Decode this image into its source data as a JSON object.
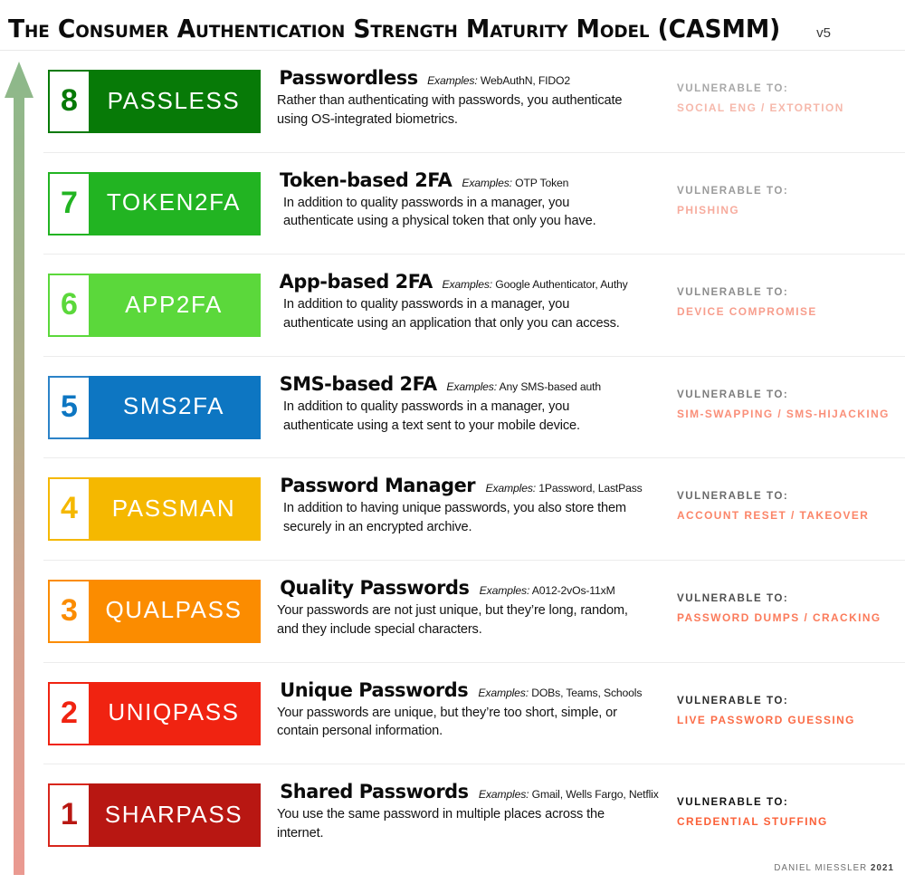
{
  "header": {
    "title": "The Consumer Authentication Strength Maturity Model (CASMM)",
    "version": "v5",
    "divider_color": "#e8e8e8"
  },
  "arrow": {
    "name": "maturity-arrow",
    "direction": "up",
    "gradient_top_color": "#8cb98a",
    "gradient_bottom_color": "#ea9a91"
  },
  "vulnerable_label": "VULNERABLE TO:",
  "rows": [
    {
      "number": "8",
      "badge_label": "PASSLESS",
      "color": "#077A07",
      "border_color": "#077A07",
      "title": "Passwordless",
      "examples_prefix": "Examples",
      "examples": "WebAuthN, FIDO2",
      "description": "Rather than authenticating with passwords, you authenticate using OS-integrated biometrics.",
      "vuln_label": "VULNERABLE TO:",
      "vuln_value": "SOCIAL ENG / EXTORTION",
      "vuln_label_color": "#a8a8a8",
      "vuln_value_color": "#f6b8ab",
      "indent": false
    },
    {
      "number": "7",
      "badge_label": "TOKEN2FA",
      "color": "#22B422",
      "border_color": "#22B422",
      "title": "Token-based 2FA",
      "examples_prefix": "Examples",
      "examples": "OTP Token",
      "description": "In addition to quality passwords in a manager, you authenticate using a physical token that only you have.",
      "vuln_label": "VULNERABLE TO:",
      "vuln_value": "PHISHING",
      "vuln_label_color": "#9b9b9b",
      "vuln_value_color": "#f7ab9d",
      "indent": true
    },
    {
      "number": "6",
      "badge_label": "APP2FA",
      "color": "#5BD83B",
      "border_color": "#5BD83B",
      "title": "App-based 2FA",
      "examples_prefix": "Examples",
      "examples": "Google Authenticator, Authy",
      "description": "In addition to quality passwords in a manager, you authenticate using an application that only you can access.",
      "vuln_label": "VULNERABLE TO:",
      "vuln_value": "DEVICE COMPROMISE",
      "vuln_label_color": "#8d8d8d",
      "vuln_value_color": "#f79d8c",
      "indent": true
    },
    {
      "number": "5",
      "badge_label": "SMS2FA",
      "color": "#0D76C2",
      "border_color": "#2C83C8",
      "title": "SMS-based 2FA",
      "examples_prefix": "Examples",
      "examples": "Any SMS-based auth",
      "description": "In addition to quality passwords in a manager, you authenticate using a text sent to your mobile device.",
      "vuln_label": "VULNERABLE TO:",
      "vuln_value": "SIM-SWAPPING / SMS-HIJACKING",
      "vuln_label_color": "#7d7d7d",
      "vuln_value_color": "#fa8f79",
      "indent": true
    },
    {
      "number": "4",
      "badge_label": "PASSMAN",
      "color": "#F5B800",
      "border_color": "#F5B800",
      "title": "Password Manager",
      "examples_prefix": "Examples",
      "examples": "1Password, LastPass",
      "description": "In addition to having unique passwords, you also store them securely in an encrypted archive.",
      "vuln_label": "VULNERABLE TO:",
      "vuln_value": "ACCOUNT RESET / TAKEOVER",
      "vuln_label_color": "#6a6a6a",
      "vuln_value_color": "#fb8568",
      "indent": true
    },
    {
      "number": "3",
      "badge_label": "QUALPASS",
      "color": "#FB8C00",
      "border_color": "#FB8C00",
      "title": "Quality Passwords",
      "examples_prefix": "Examples",
      "examples": "A012-2vOs-11xM",
      "description": "Your passwords are not just unique, but they’re long, random, and they include special characters.",
      "vuln_label": "VULNERABLE TO:",
      "vuln_value": "PASSWORD DUMPS / CRACKING",
      "vuln_label_color": "#4e4e4e",
      "vuln_value_color": "#fb7a5a",
      "indent": false
    },
    {
      "number": "2",
      "badge_label": "UNIQPASS",
      "color": "#F02311",
      "border_color": "#F02311",
      "title": "Unique Passwords",
      "examples_prefix": "Examples",
      "examples": "DOBs, Teams, Schools",
      "description": "Your passwords are unique, but they’re too short, simple, or contain personal information.",
      "vuln_label": "VULNERABLE TO:",
      "vuln_value": "LIVE PASSWORD GUESSING",
      "vuln_label_color": "#2c2c2c",
      "vuln_value_color": "#fb6c47",
      "indent": false
    },
    {
      "number": "1",
      "badge_label": "SHARPASS",
      "color": "#B81712",
      "border_color": "#D8261C",
      "title": "Shared Passwords",
      "examples_prefix": "Examples",
      "examples": "Gmail, Wells Fargo, Netflix",
      "description": "You use the same password in multiple places across the internet.",
      "vuln_label": "VULNERABLE TO:",
      "vuln_value": "CREDENTIAL STUFFING",
      "vuln_label_color": "#121212",
      "vuln_value_color": "#fb6038",
      "indent": false
    }
  ],
  "credit": {
    "author": "DANIEL MIESSLER",
    "year": "2021"
  }
}
